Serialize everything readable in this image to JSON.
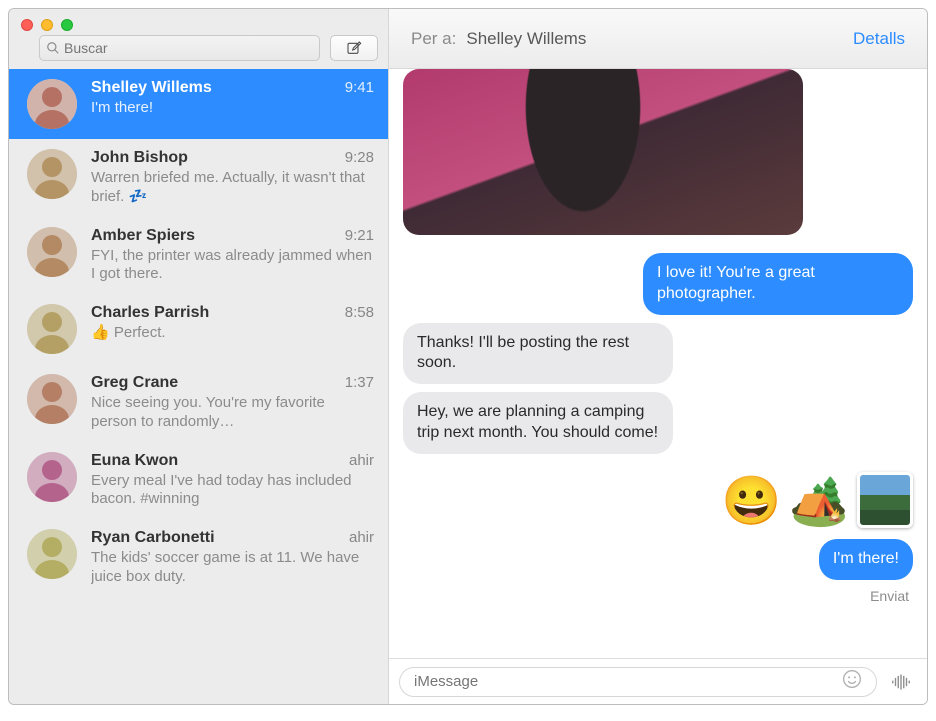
{
  "sidebar": {
    "search_placeholder": "Buscar",
    "conversations": [
      {
        "name": "Shelley Willems",
        "time": "9:41",
        "preview": "I'm there!",
        "selected": true
      },
      {
        "name": "John Bishop",
        "time": "9:28",
        "preview": "Warren briefed me. Actually, it wasn't that brief. 💤"
      },
      {
        "name": "Amber Spiers",
        "time": "9:21",
        "preview": "FYI, the printer was already jammed when I got there."
      },
      {
        "name": "Charles Parrish",
        "time": "8:58",
        "preview": "👍 Perfect."
      },
      {
        "name": "Greg Crane",
        "time": "1:37",
        "preview": "Nice seeing you. You're my favorite person to randomly…"
      },
      {
        "name": "Euna Kwon",
        "time": "ahir",
        "preview": "Every meal I've had today has included bacon. #winning"
      },
      {
        "name": "Ryan Carbonetti",
        "time": "ahir",
        "preview": "The kids' soccer game is at 11. We have juice box duty."
      }
    ]
  },
  "header": {
    "to_label": "Per a:",
    "recipient": "Shelley Willems",
    "details_label": "Detalls"
  },
  "thread": {
    "messages": [
      {
        "type": "attachment"
      },
      {
        "type": "bubble",
        "direction": "sent",
        "text": "I love it! You're a great photographer."
      },
      {
        "type": "bubble",
        "direction": "recv",
        "text": "Thanks! I'll be posting the rest soon."
      },
      {
        "type": "bubble",
        "direction": "recv",
        "text": "Hey, we are planning a camping trip next month. You should come!"
      },
      {
        "type": "emoji_row",
        "emojis": [
          "😀",
          "🏕️"
        ],
        "has_photo_thumb": true
      },
      {
        "type": "bubble",
        "direction": "sent",
        "text": "I'm there!"
      }
    ],
    "status": "Enviat"
  },
  "input": {
    "placeholder": "iMessage"
  }
}
